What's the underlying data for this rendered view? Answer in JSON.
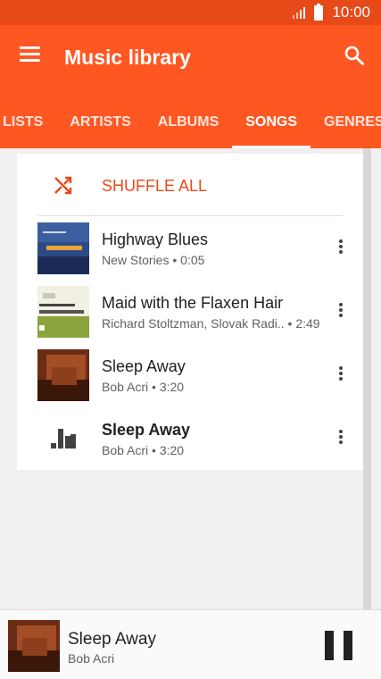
{
  "status_bar": {
    "time": "10:00"
  },
  "app_bar": {
    "title": "Music library",
    "accent": "#ff5722",
    "status_color": "#e64a19"
  },
  "tabs": [
    {
      "label": "LISTS",
      "active": false
    },
    {
      "label": "ARTISTS",
      "active": false
    },
    {
      "label": "ALBUMS",
      "active": false
    },
    {
      "label": "SONGS",
      "active": true
    },
    {
      "label": "GENRES",
      "active": false
    }
  ],
  "shuffle": {
    "label": "SHUFFLE ALL",
    "icon": "shuffle-icon"
  },
  "songs": [
    {
      "title": "Highway Blues",
      "subtitle": "New Stories • 0:05",
      "art": "album-art-blue",
      "playing": false
    },
    {
      "title": "Maid with the Flaxen Hair",
      "subtitle": "Richard Stoltzman, Slovak Radi.. • 2:49",
      "art": "album-art-green",
      "playing": false
    },
    {
      "title": "Sleep Away",
      "subtitle": "Bob Acri • 3:20",
      "art": "album-art-warm",
      "playing": false
    },
    {
      "title": "Sleep Away",
      "subtitle": "Bob Acri • 3:20",
      "art": "equalizer-icon",
      "playing": true
    }
  ],
  "now_playing": {
    "title": "Sleep Away",
    "artist": "Bob Acri",
    "control": "pause-icon"
  }
}
